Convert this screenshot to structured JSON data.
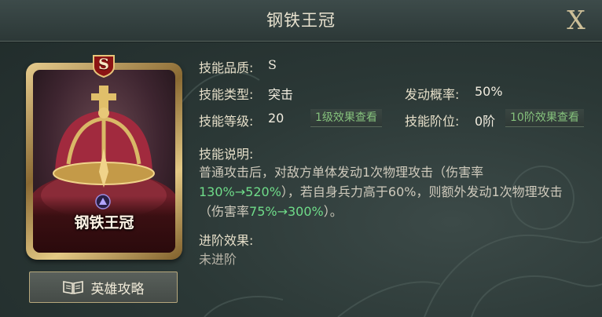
{
  "title": "钢铁王冠",
  "close_label": "X",
  "card": {
    "grade_badge": "S",
    "name": "钢铁王冠"
  },
  "guide_button": {
    "label": "英雄攻略",
    "icon": "book-icon"
  },
  "skill": {
    "quality_label": "技能品质:",
    "quality_value": "S",
    "type_label": "技能类型:",
    "type_value": "突击",
    "chance_label": "发动概率:",
    "chance_value": "50%",
    "level_label": "技能等级:",
    "level_value": "20",
    "level_link": "1级效果查看",
    "tier_label": "技能阶位:",
    "tier_value": "0阶",
    "tier_link": "10阶效果查看",
    "desc_label": "技能说明:",
    "desc_parts": {
      "p1": "普通攻击后，对敌方单体发动1次物理攻击（伤害率",
      "h1": "130%→520%",
      "p2": "），若自身兵力高于60%，则额外发动1次物理攻击（伤害率",
      "h2": "75%→300%",
      "p3": "）。"
    },
    "advance_label": "进阶效果:",
    "advance_value": "未进阶"
  },
  "colors": {
    "highlight": "#6fdc89",
    "link": "#85c17c",
    "gold": "#cdbf98"
  }
}
